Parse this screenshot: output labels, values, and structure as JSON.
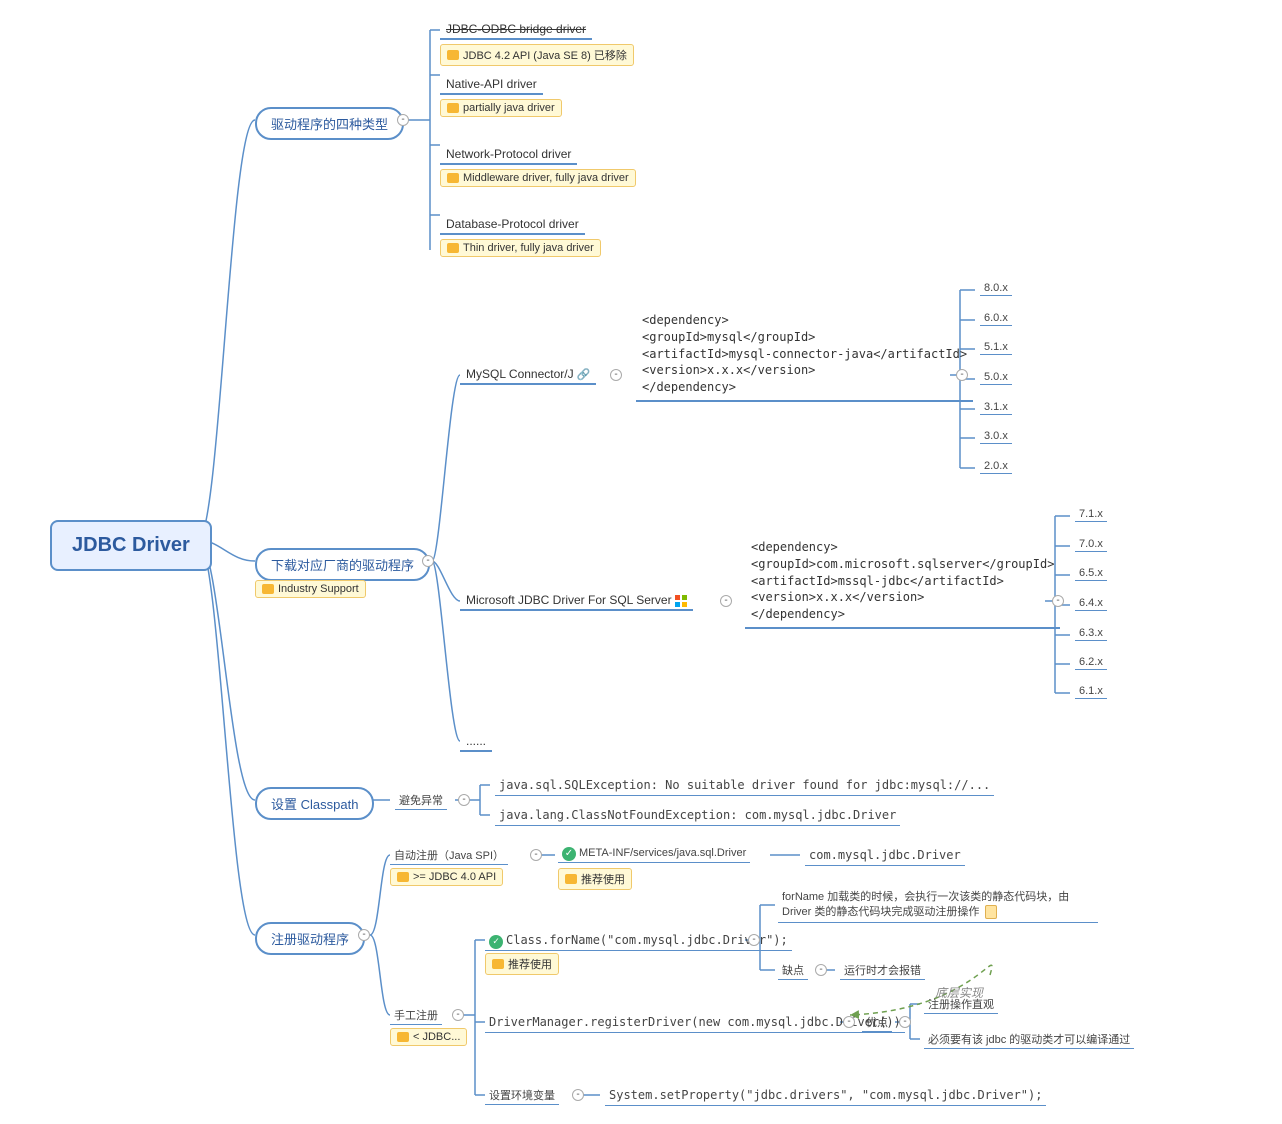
{
  "root": "JDBC Driver",
  "branches": {
    "types": "驱动程序的四种类型",
    "download": "下载对应厂商的驱动程序",
    "download_note": "Industry Support",
    "classpath": "设置 Classpath",
    "classpath_label": "避免异常",
    "register": "注册驱动程序"
  },
  "types_list": {
    "jdbc_odbc": "JDBC-ODBC bridge driver",
    "jdbc_odbc_note": "JDBC 4.2 API (Java SE 8) 已移除",
    "native": "Native-API driver",
    "native_note": "partially java driver",
    "network": "Network-Protocol driver",
    "network_note": "Middleware driver, fully java driver",
    "database": "Database-Protocol driver",
    "database_note": "Thin driver, fully java driver"
  },
  "download": {
    "mysql_label": "MySQL Connector/J",
    "mysql_dep_l1": "<dependency>",
    "mysql_dep_l2": "    <groupId>mysql</groupId>",
    "mysql_dep_l3": "    <artifactId>mysql-connector-java</artifactId>",
    "mysql_dep_l4": "    <version>x.x.x</version>",
    "mysql_dep_l5": "</dependency>",
    "mysql_versions": [
      "8.0.x",
      "6.0.x",
      "5.1.x",
      "5.0.x",
      "3.1.x",
      "3.0.x",
      "2.0.x"
    ],
    "mssql_label": "Microsoft JDBC Driver For SQL Server",
    "mssql_dep_l1": "<dependency>",
    "mssql_dep_l2": "    <groupId>com.microsoft.sqlserver</groupId>",
    "mssql_dep_l3": "    <artifactId>mssql-jdbc</artifactId>",
    "mssql_dep_l4": "    <version>x.x.x</version>",
    "mssql_dep_l5": "</dependency>",
    "mssql_versions": [
      "7.1.x",
      "7.0.x",
      "6.5.x",
      "6.4.x",
      "6.3.x",
      "6.2.x",
      "6.1.x"
    ],
    "more": "......"
  },
  "classpath": {
    "err1": "java.sql.SQLException: No suitable driver found for jdbc:mysql://...",
    "err2": "java.lang.ClassNotFoundException: com.mysql.jdbc.Driver"
  },
  "register": {
    "auto": "自动注册（Java SPI）",
    "auto_note": ">= JDBC 4.0 API",
    "auto_child1": "META-INF/services/java.sql.Driver",
    "auto_child1_note": "推荐使用",
    "auto_child2": "com.mysql.jdbc.Driver",
    "manual": "手工注册",
    "manual_note": "< JDBC...",
    "forname": "Class.forName(\"com.mysql.jdbc.Driver\");",
    "forname_note": "推荐使用",
    "forname_desc": "forName 加载类的时候，会执行一次该类的静态代码块，由 Driver 类的静态代码块完成驱动注册操作",
    "forname_con_label": "缺点",
    "forname_con": "运行时才会报错",
    "regdriver": "DriverManager.registerDriver(new com.mysql.jdbc.Driver())",
    "regdriver_pro_label": "优点",
    "regdriver_pro1": "注册操作直观",
    "regdriver_pro2": "必须要有该 jdbc 的驱动类才可以编译通过",
    "env": "设置环境变量",
    "env_code": "System.setProperty(\"jdbc.drivers\", \"com.mysql.jdbc.Driver\");",
    "impl_label": "底层实现"
  }
}
